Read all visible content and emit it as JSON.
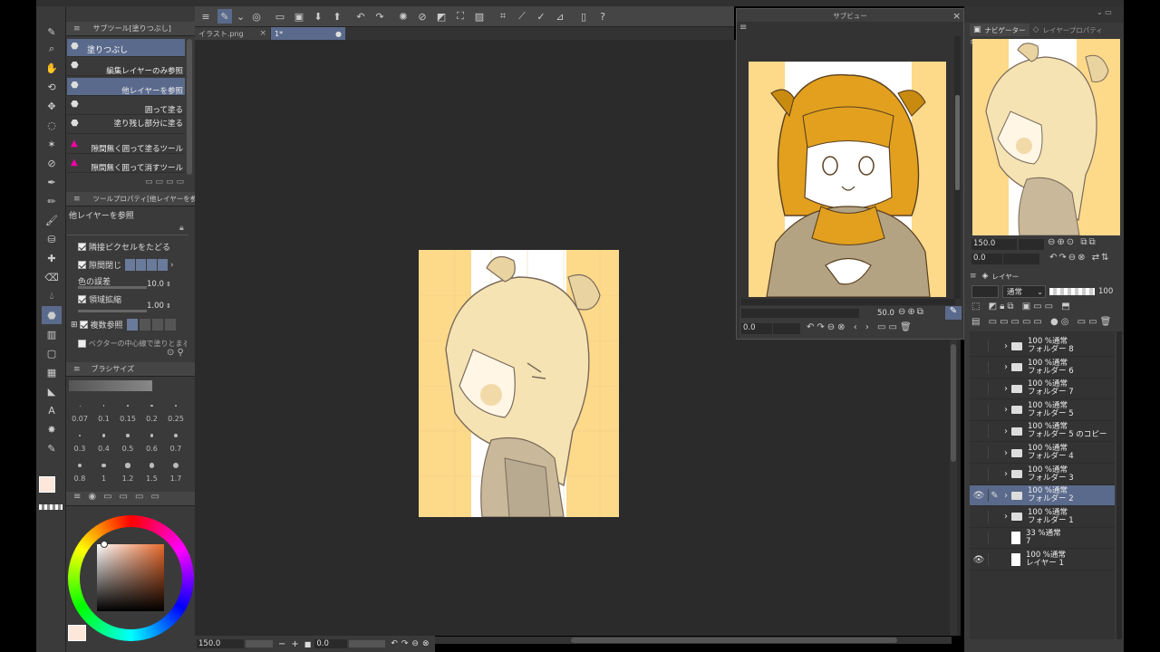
{
  "sub_tool": {
    "title": "サブツール[塗りつぶし]",
    "items": [
      {
        "label": "塗りつぶし",
        "selected": true
      },
      {
        "label": "編集レイヤーのみ参照"
      },
      {
        "label": "他レイヤーを参照",
        "selected": true
      },
      {
        "label": "囲って塗る"
      },
      {
        "label": "塗り残し部分に塗る"
      },
      {
        "label": "隙間無く囲って塗るツール"
      },
      {
        "label": "隙間無く囲って消すツール"
      }
    ]
  },
  "tool_property": {
    "title": "ツールプロパティ[他レイヤーを参照]",
    "name": "他レイヤーを参照",
    "follow_adjacent": "隣接ピクセルをたどる",
    "close_gap": "隙間閉じ",
    "color_margin_label": "色の誤差",
    "color_margin_value": "10.0",
    "area_scaling_label": "領域拡縮",
    "area_scaling_value": "1.00",
    "multi_ref": "複数参照",
    "vector_center": "ベクターの中心線で塗りとまる"
  },
  "brush_size": {
    "title": "ブラシサイズ",
    "values": [
      "0.07",
      "0.1",
      "0.15",
      "0.2",
      "0.25",
      "0.3",
      "0.4",
      "0.5",
      "0.6",
      "0.7",
      "0.8",
      "1",
      "1.2",
      "1.5",
      "1.7"
    ]
  },
  "tabs": [
    {
      "label": "イラスト.png"
    },
    {
      "label": "1*",
      "active": true
    }
  ],
  "subview": {
    "title": "サブビュー",
    "zoom": "50.0",
    "angle": "0.0"
  },
  "navigator": {
    "tab1": "ナビゲーター",
    "tab2": "レイヤープロパティ",
    "zoom": "150.0",
    "angle": "0.0"
  },
  "layers_panel": {
    "title": "レイヤー",
    "blend_mode": "通常",
    "opacity": "100",
    "layers": [
      {
        "top": "100 %通常",
        "bottom": "フォルダー 8",
        "type": "folder"
      },
      {
        "top": "100 %通常",
        "bottom": "フォルダー 6",
        "type": "folder"
      },
      {
        "top": "100 %通常",
        "bottom": "フォルダー 7",
        "type": "folder"
      },
      {
        "top": "100 %通常",
        "bottom": "フォルダー 5",
        "type": "folder"
      },
      {
        "top": "100 %通常",
        "bottom": "フォルダー 5 のコピー",
        "type": "folder"
      },
      {
        "top": "100 %通常",
        "bottom": "フォルダー 4",
        "type": "folder"
      },
      {
        "top": "100 %通常",
        "bottom": "フォルダー 3",
        "type": "folder"
      },
      {
        "top": "100 %通常",
        "bottom": "フォルダー 2",
        "type": "folder",
        "selected": true,
        "visible": true
      },
      {
        "top": "100 %通常",
        "bottom": "フォルダー 1",
        "type": "folder"
      },
      {
        "top": "33 %通常",
        "bottom": "7",
        "type": "raster"
      },
      {
        "top": "100 %通常",
        "bottom": "レイヤー 1",
        "type": "raster",
        "visible": true
      }
    ]
  },
  "status": {
    "zoom": "150.0",
    "angle": "0.0"
  },
  "colors": {
    "canvas_yellow": "#fdd98a",
    "ui_bg": "#3a3a3a",
    "canvas_bg": "#2b2b2b",
    "selection": "#5a6a8c"
  }
}
